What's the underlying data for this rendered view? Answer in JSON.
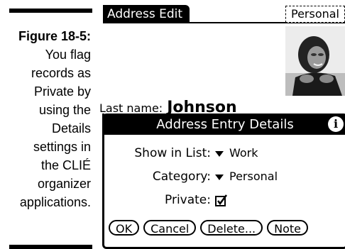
{
  "caption": {
    "figure": "Figure 18-5:",
    "lines": [
      "You flag",
      "records as",
      "Private by",
      "using the",
      "Details",
      "settings in",
      "the CLIÉ",
      "organizer",
      "applications."
    ]
  },
  "screen": {
    "title": "Address Edit",
    "category_selector": "Personal",
    "last_name_label": "Last name:",
    "last_name_value": "Johnson"
  },
  "dialog": {
    "title": "Address Entry Details",
    "info_icon": "info-icon",
    "fields": {
      "show_in_list_label": "Show in List:",
      "show_in_list_value": "Work",
      "category_label": "Category:",
      "category_value": "Personal",
      "private_label": "Private:",
      "private_checked": true
    },
    "buttons": {
      "ok": "OK",
      "cancel": "Cancel",
      "delete": "Delete...",
      "note": "Note"
    }
  }
}
